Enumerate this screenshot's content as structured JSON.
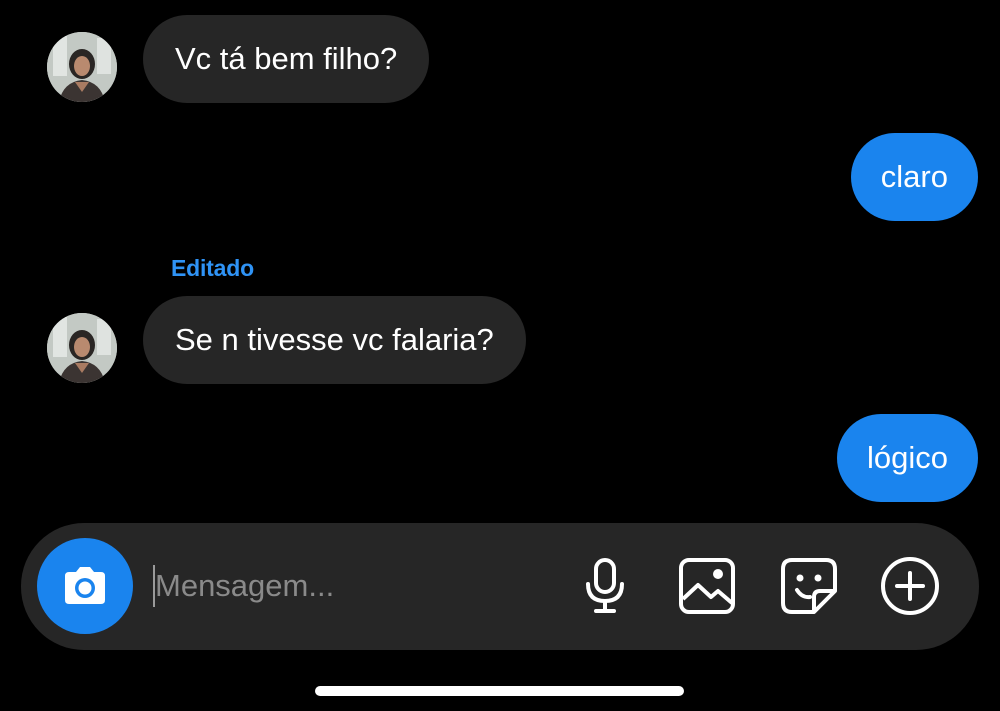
{
  "conversation": {
    "messages": [
      {
        "direction": "incoming",
        "text": "Vc tá bem filho?"
      },
      {
        "direction": "outgoing",
        "text": "claro"
      },
      {
        "direction": "incoming",
        "text": "Se n tivesse vc falaria?",
        "edited_label": "Editado"
      },
      {
        "direction": "outgoing",
        "text": "lógico"
      }
    ]
  },
  "composer": {
    "placeholder": "Mensagem...",
    "icons": [
      "camera-icon",
      "microphone-icon",
      "gallery-icon",
      "sticker-icon",
      "plus-icon"
    ]
  },
  "colors": {
    "background": "#000000",
    "incoming_bubble": "#262626",
    "outgoing_bubble": "#1a84ee",
    "accent": "#1a84ee",
    "edited_label": "#2f93f5"
  }
}
